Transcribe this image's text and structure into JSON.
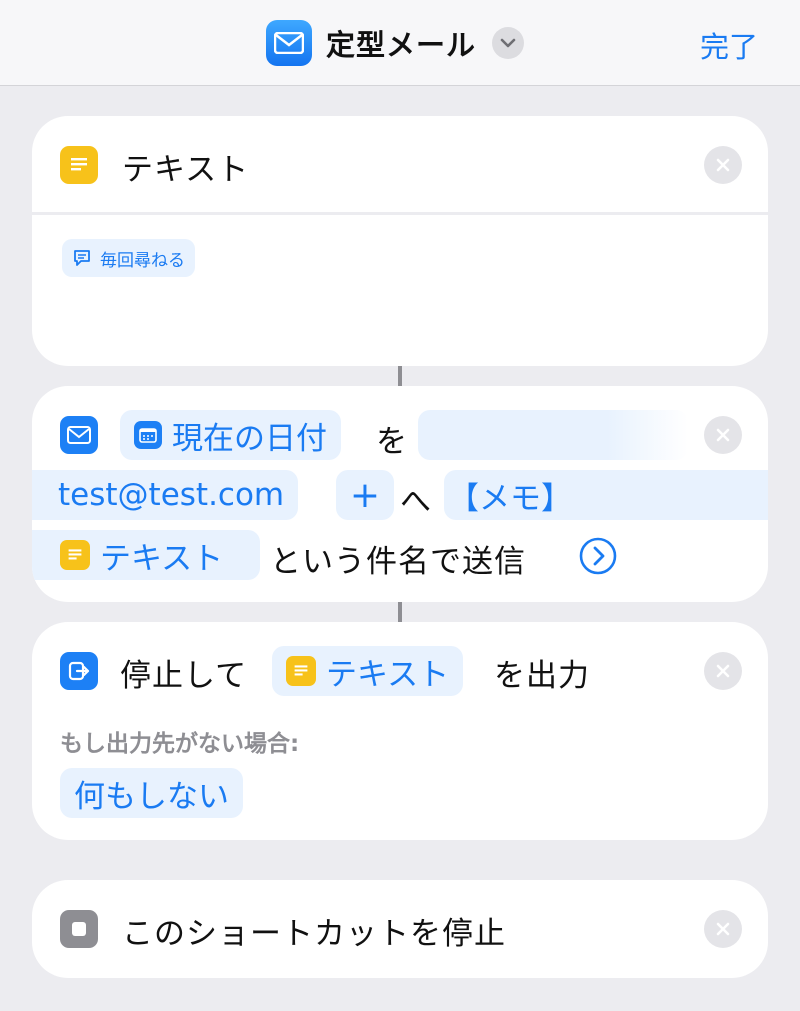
{
  "nav": {
    "title": "定型メール",
    "done_label": "完了",
    "app_icon": "envelope-icon"
  },
  "card_text": {
    "title": "テキスト",
    "ask_each_time": "毎回尋ねる"
  },
  "card_mail": {
    "date_token": "現在の日付",
    "particle_wo": "を",
    "recipient_token": "test@test.com",
    "add_label": "+",
    "particle_e": "へ",
    "memo_token": "【メモ】",
    "text_token": "テキスト",
    "subject_suffix": "という件名で送信"
  },
  "card_stop_output": {
    "prefix": "停止して",
    "text_token": "テキスト",
    "suffix": "を出力",
    "no_output_label": "もし出力先がない場合:",
    "no_output_value": "何もしない"
  },
  "card_stop": {
    "title": "このショートカットを停止"
  },
  "colors": {
    "accent": "#1a7bf2",
    "text_yellow": "#f7c21a",
    "background": "#ececf0"
  }
}
